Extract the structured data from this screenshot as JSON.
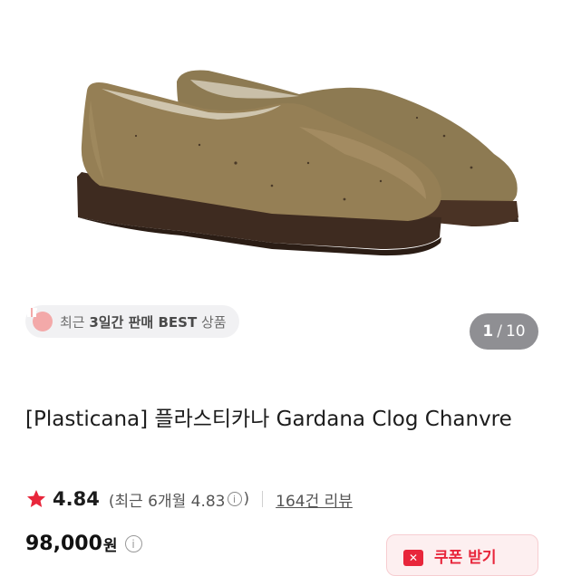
{
  "hero": {
    "image_alt": "Plasticana Gardana clog shoes, brown rubber",
    "best_badge": {
      "prefix": "최근 ",
      "bold": "3일간 판매 BEST",
      "suffix": " 상품"
    },
    "counter": {
      "current": "1",
      "separator": "/",
      "total": "10"
    }
  },
  "product": {
    "title": "[Plasticana] 플라스티카나 Gardana Clog Chanvre",
    "rating": "4.84",
    "recent_open": "(최근 6개월 4.83",
    "recent_close": ")",
    "reviews": "164건 리뷰",
    "price": "98,000",
    "currency": "원",
    "coupon_label": "쿠폰 받기"
  },
  "colors": {
    "accent": "#e8263b",
    "star": "#e8263b",
    "counter_bg": "#8f8f93"
  }
}
